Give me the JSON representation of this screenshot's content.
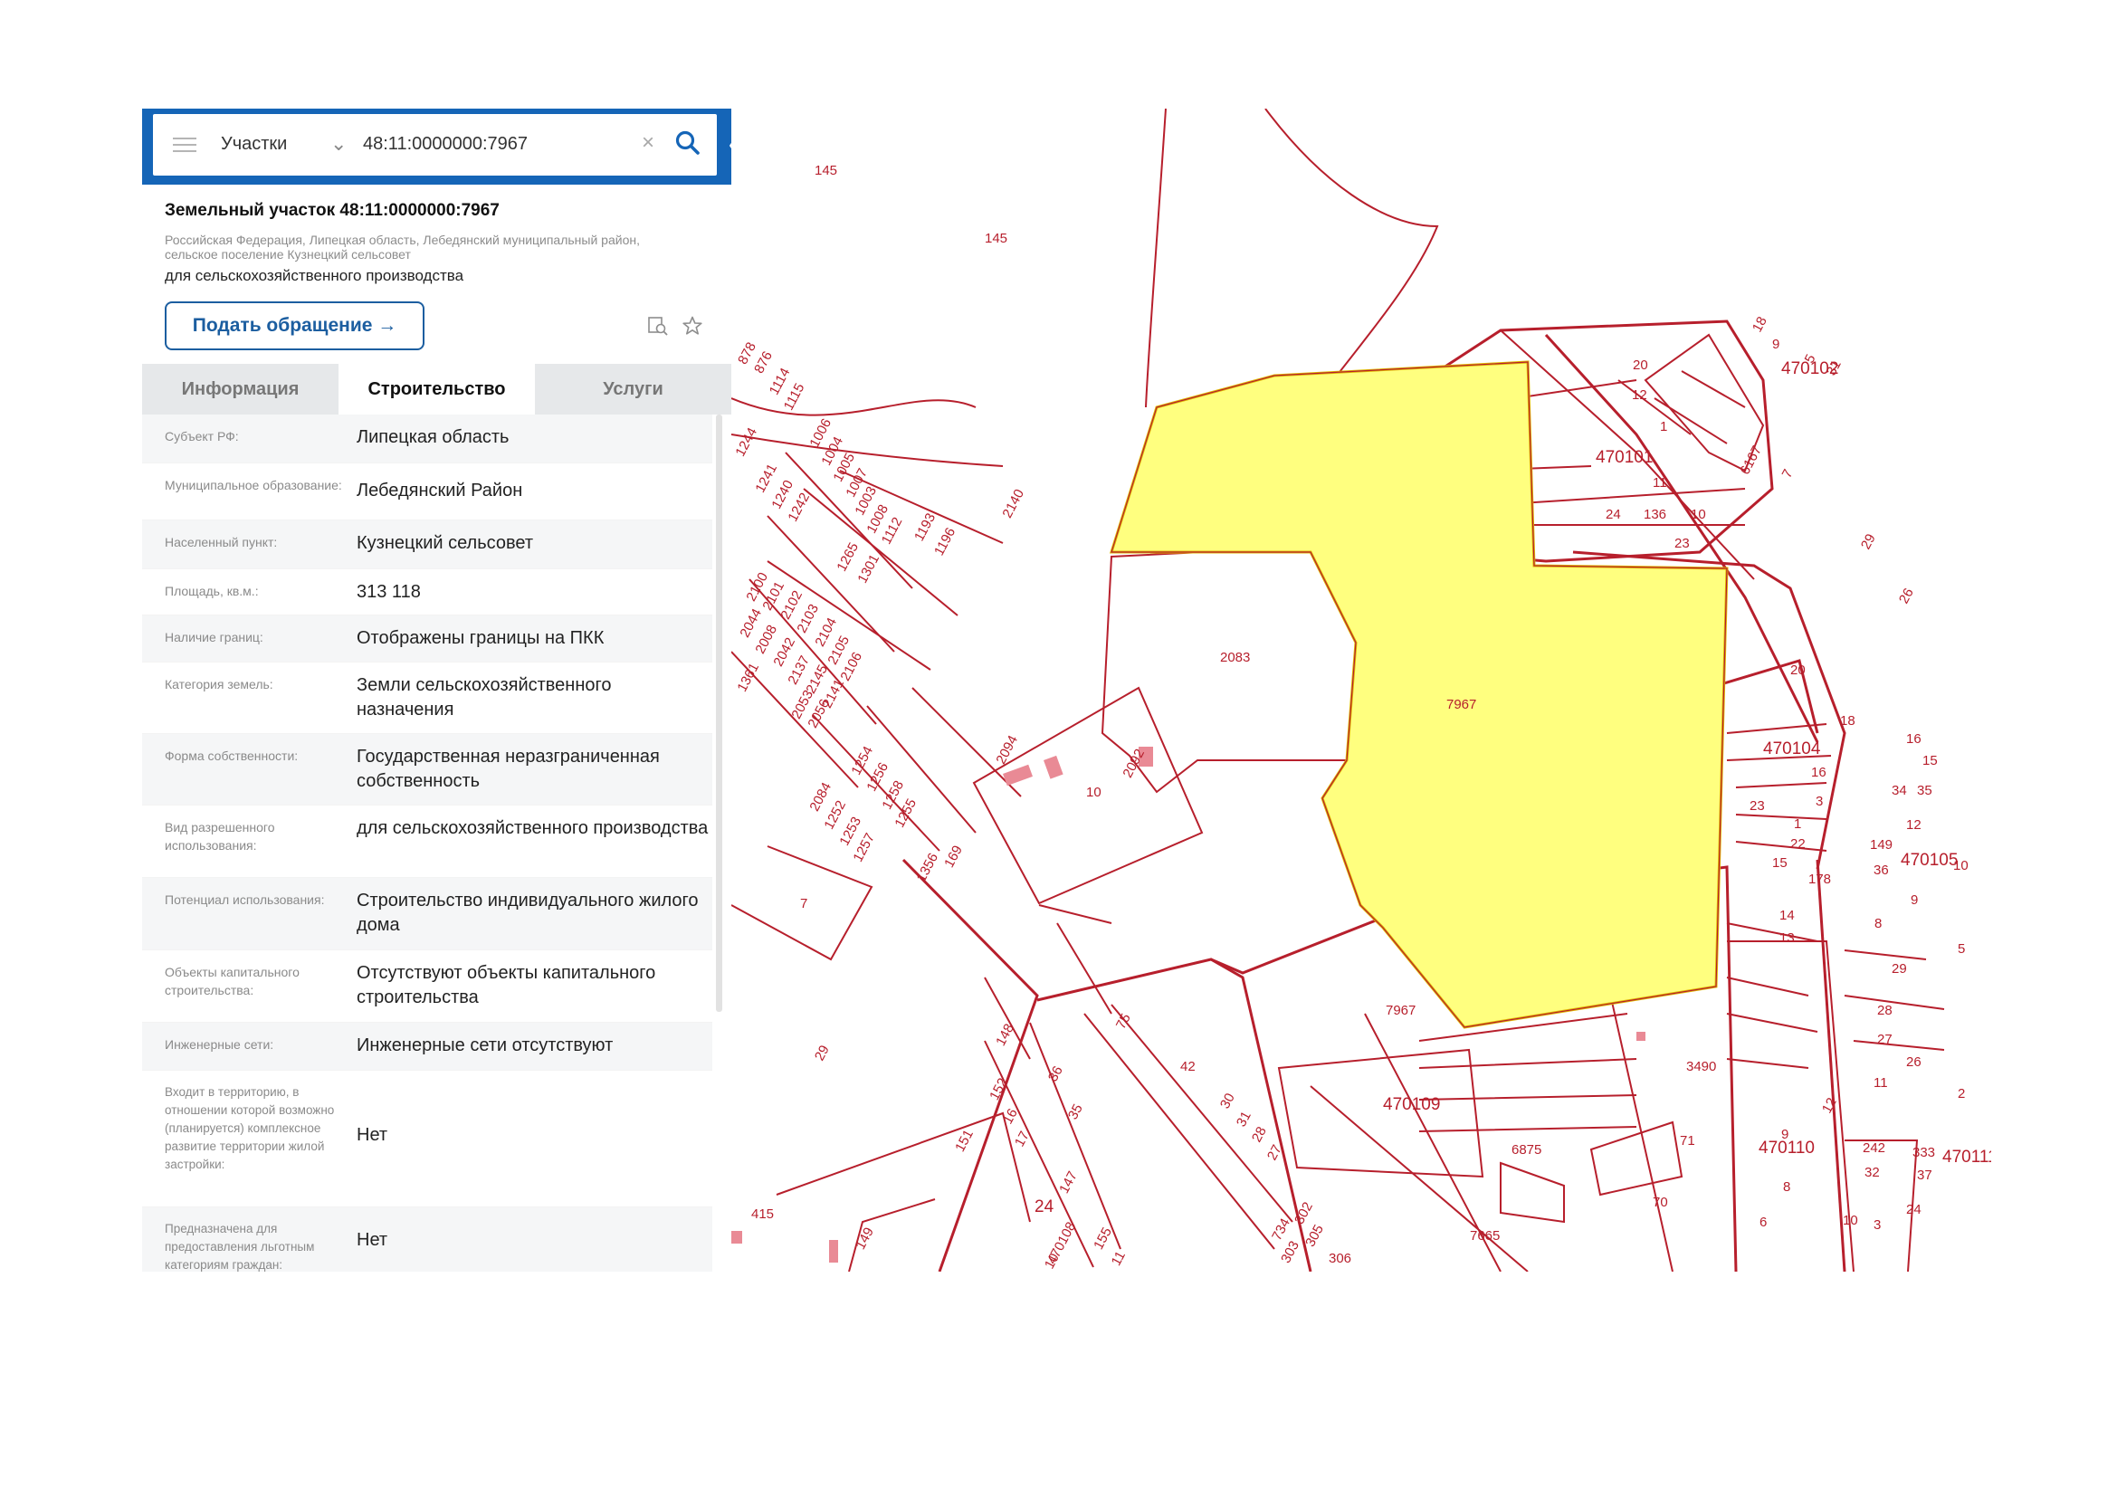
{
  "search": {
    "layer": "Участки",
    "query": "48:11:0000000:7967"
  },
  "plot": {
    "title": "Земельный участок 48:11:0000000:7967",
    "address": "Российская Федерация, Липецкая область, Лебедянский муниципальный район, сельское поселение Кузнецкий сельсовет",
    "purpose": "для сельскохозяйственного производства",
    "appeal_button": "Подать обращение →"
  },
  "tabs": [
    "Информация",
    "Строительство",
    "Услуги"
  ],
  "active_tab": 1,
  "rows": [
    {
      "key": "Субъект РФ:",
      "value": "Липецкая область"
    },
    {
      "key": "Муниципальное образование:",
      "value": "Лебедянский Район"
    },
    {
      "key": "Населенный пункт:",
      "value": "Кузнецкий сельсовет"
    },
    {
      "key": "Площадь, кв.м.:",
      "value": "313 118"
    },
    {
      "key": "Наличие границ:",
      "value": "Отображены границы на ПКК"
    },
    {
      "key": "Категория земель:",
      "value": "Земли сельскохозяйственного назначения"
    },
    {
      "key": "Форма собственности:",
      "value": "Государственная неразграниченная собственность"
    },
    {
      "key": "Вид разрешенного использования:",
      "value": "для сельскохозяйственного производства"
    },
    {
      "key": "Потенциал использования:",
      "value": "Строительство индивидуального жилого дома"
    },
    {
      "key": "Объекты капитального строительства:",
      "value": "Отсутствуют объекты капитального строительства"
    },
    {
      "key": "Инженерные сети:",
      "value": "Инженерные сети отсутствуют"
    },
    {
      "key": "Входит в территорию, в отношении которой возможно (планируется) комплексное развитие территории жилой застройки:",
      "value": "Нет"
    },
    {
      "key": "Предназначена для предоставления льготным категориям граждан:",
      "value": "Нет"
    }
  ],
  "icons": {
    "menu": "menu-icon",
    "dropdown": "chevron-down-icon",
    "clear": "close-icon",
    "search": "search-icon",
    "collapse": "chevron-left-icon",
    "zoom_to": "zoom-to-icon",
    "favorite": "star-icon"
  },
  "colors": {
    "accent": "#1565b7",
    "boundary": "#b71f2c",
    "highlight_fill": "#ffff7f",
    "highlight_stroke": "#e0b800"
  },
  "map_labels": [
    "145",
    "145",
    "7967",
    "7967",
    "2083",
    "2094",
    "2092",
    "10",
    "7",
    "470101",
    "20",
    "12",
    "1",
    "11",
    "24",
    "136",
    "10",
    "23",
    "470102",
    "18",
    "9",
    "31",
    "5",
    "7",
    "6167",
    "29",
    "26",
    "20",
    "18",
    "470104",
    "16",
    "3",
    "23",
    "1",
    "22",
    "15",
    "178",
    "14",
    "13",
    "16",
    "15",
    "34",
    "35",
    "12",
    "149",
    "470105",
    "36",
    "10",
    "9",
    "8",
    "29",
    "5",
    "28",
    "27",
    "26",
    "2",
    "11",
    "12",
    "470110",
    "9",
    "242",
    "333",
    "470111",
    "32",
    "37",
    "8",
    "24",
    "6",
    "10",
    "3490",
    "71",
    "70",
    "6875",
    "470109",
    "7665",
    "878",
    "876",
    "1114",
    "1115",
    "1244",
    "1006",
    "1004",
    "1005",
    "1007",
    "1241",
    "1240",
    "1242",
    "1003",
    "1008",
    "1112",
    "1193",
    "1196",
    "2140",
    "1265",
    "1301",
    "2100",
    "2101",
    "2102",
    "2103",
    "2044",
    "2008",
    "2042",
    "2137",
    "2104",
    "2105",
    "2106",
    "2145",
    "2141",
    "1361",
    "2053",
    "2056",
    "1254",
    "2084",
    "1256",
    "1258",
    "1252",
    "1253",
    "1255",
    "1257",
    "1356",
    "169",
    "75",
    "148",
    "42",
    "30",
    "31",
    "28",
    "27",
    "36",
    "35",
    "152",
    "16",
    "17",
    "147",
    "24",
    "470108",
    "155",
    "11",
    "151",
    "29",
    "415",
    "149",
    "734",
    "302",
    "303",
    "305",
    "306",
    "3",
    "10",
    "20"
  ]
}
